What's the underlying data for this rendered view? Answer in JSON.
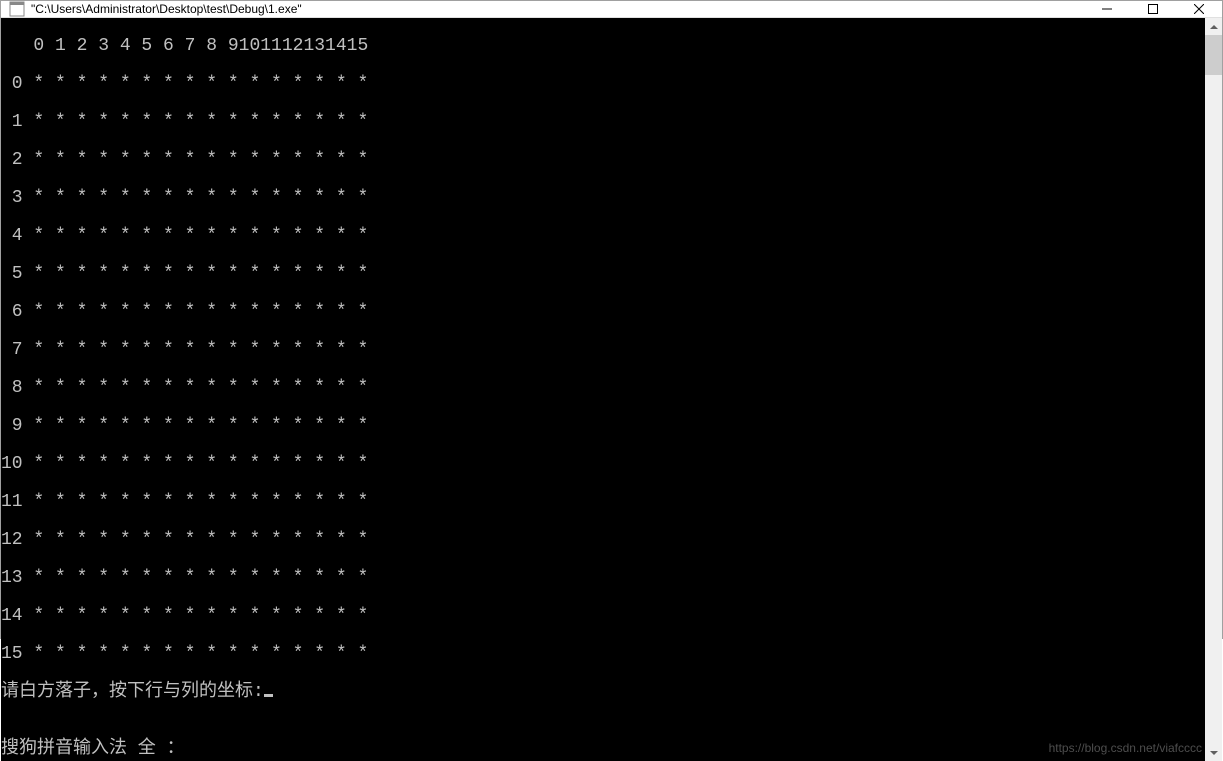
{
  "window": {
    "title": "\"C:\\Users\\Administrator\\Desktop\\test\\Debug\\1.exe\""
  },
  "console": {
    "header_row": "   0 1 2 3 4 5 6 7 8 9101112131415",
    "board_rows": [
      " 0 * * * * * * * * * * * * * * * *",
      " 1 * * * * * * * * * * * * * * * *",
      " 2 * * * * * * * * * * * * * * * *",
      " 3 * * * * * * * * * * * * * * * *",
      " 4 * * * * * * * * * * * * * * * *",
      " 5 * * * * * * * * * * * * * * * *",
      " 6 * * * * * * * * * * * * * * * *",
      " 7 * * * * * * * * * * * * * * * *",
      " 8 * * * * * * * * * * * * * * * *",
      " 9 * * * * * * * * * * * * * * * *",
      "10 * * * * * * * * * * * * * * * *",
      "11 * * * * * * * * * * * * * * * *",
      "12 * * * * * * * * * * * * * * * *",
      "13 * * * * * * * * * * * * * * * *",
      "14 * * * * * * * * * * * * * * * *",
      "15 * * * * * * * * * * * * * * * *"
    ],
    "prompt": "请白方落子，按下行与列的坐标:",
    "status": "搜狗拼音输入法 全 ："
  },
  "watermark": "https://blog.csdn.net/viafcccc"
}
